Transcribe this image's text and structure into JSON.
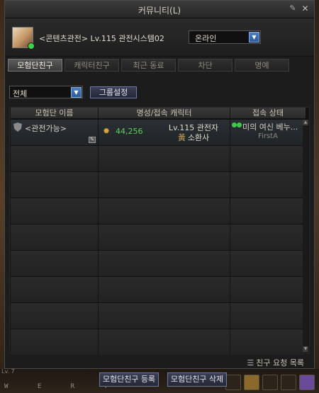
{
  "window": {
    "title": "커뮤니티(L)"
  },
  "profile": {
    "my_name": "<콘텐츠관전>",
    "my_level_title": "Lv.115 관전시스템02",
    "status_value": "온라인"
  },
  "tabs": [
    {
      "label": "모험단친구",
      "active": true
    },
    {
      "label": "캐릭터친구",
      "active": false
    },
    {
      "label": "최근 동료",
      "active": false
    },
    {
      "label": "차단",
      "active": false
    },
    {
      "label": "명예",
      "active": false
    }
  ],
  "filter": {
    "value": "전체",
    "group_button": "그룹설정"
  },
  "table": {
    "headers": [
      "모험단 이름",
      "명성/접속 캐릭터",
      "접속 상태"
    ],
    "rows": [
      {
        "guild": "<관전가능>",
        "fame": "44,256",
        "level": "Lv.115 관전자",
        "class_icon": "黃",
        "class": "소환사",
        "location": "미의 여신 베누...",
        "server": "FirstA"
      }
    ],
    "empty_rows": 8
  },
  "request_link": "친구 요청 목록",
  "buttons": {
    "register": "모험단친구 등록",
    "delete": "모험단친구 삭제"
  },
  "hud": {
    "level": "Lv. 7",
    "keys": "W E R T"
  },
  "colors": {
    "online": "#3bd34a",
    "fame": "#5fcf5f",
    "accent_blue": "#4fb0d8"
  }
}
